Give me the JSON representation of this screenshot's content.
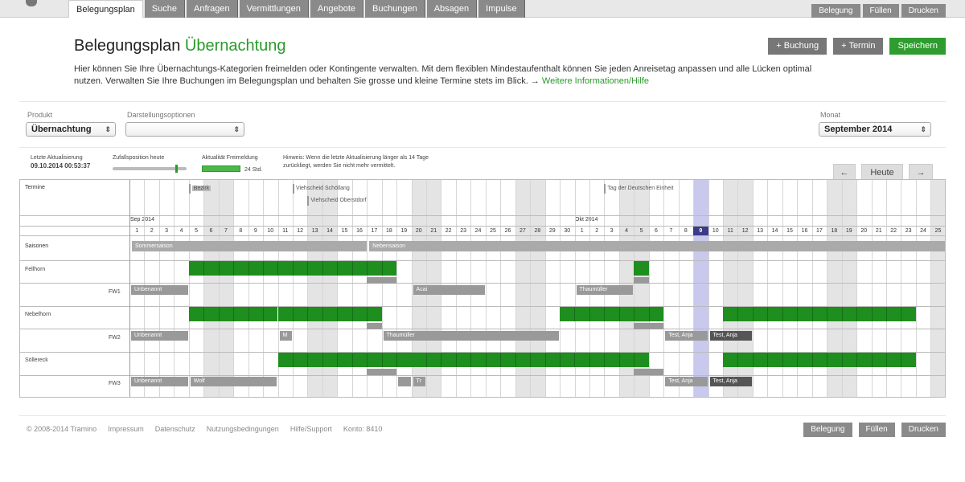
{
  "nav": {
    "tabs": [
      {
        "label": "Belegungsplan",
        "active": true
      },
      {
        "label": "Suche"
      },
      {
        "label": "Anfragen"
      },
      {
        "label": "Vermittlungen"
      },
      {
        "label": "Angebote"
      },
      {
        "label": "Buchungen"
      },
      {
        "label": "Absagen"
      },
      {
        "label": "Impulse"
      }
    ],
    "right_buttons": [
      "Belegung",
      "Füllen",
      "Drucken"
    ]
  },
  "header": {
    "title": "Belegungsplan",
    "subtitle": "Übernachtung",
    "add_booking": "+ Buchung",
    "add_appointment": "+ Termin",
    "save": "Speichern"
  },
  "description": {
    "text": "Hier können Sie Ihre Übernachtungs-Kategorien freimelden oder Kontingente verwalten. Mit dem flexiblen Mindestaufenthalt können Sie jeden Anreisetag anpassen und alle Lücken optimal nutzen. Verwalten Sie Ihre Buchungen im Belegungsplan und behalten Sie grosse und kleine Termine stets im Blick. →",
    "link": "Weitere Informationen/Hilfe"
  },
  "filters": {
    "product_label": "Produkt",
    "product_value": "Übernachtung",
    "options_label": "Darstellungsoptionen",
    "options_value": "",
    "month_label": "Monat",
    "month_value": "September 2014"
  },
  "status": {
    "last_update_label": "Letzte Aktualisierung",
    "last_update_value": "09.10.2014 00:53:37",
    "slider_label": "Zufallsposition heute",
    "freshness_label": "Aktualität Freimeldung",
    "freshness_value": "24 Std.",
    "hint": "Hinweis: Wenn die letzte Aktualisierung länger als 14 Tage zurückliegt, werden Sie nicht mehr vermittelt."
  },
  "navigation": {
    "prev": "←",
    "today": "Heute",
    "next": "→"
  },
  "calendar": {
    "termine_label": "Termine",
    "saisonen_label": "Saisonen",
    "month1": "Sep 2014",
    "month2": "Okt 2014",
    "events": [
      {
        "label": "Bezirk",
        "start": 5,
        "len": 2
      },
      {
        "label": "Viehscheid Schöllang",
        "start": 12,
        "len": 5
      },
      {
        "label": "Viehscheid Oberstdorf",
        "start": 13,
        "len": 5
      },
      {
        "label": "Tag der Deutschen Einheit",
        "start": 33,
        "len": 6
      }
    ],
    "seasons": [
      {
        "label": "Sommersaison",
        "start": 1,
        "len": 16
      },
      {
        "label": "Nebensaison",
        "start": 17,
        "len": 39
      }
    ],
    "today_index": 39,
    "rows": [
      {
        "name": "Fellhorn",
        "sub": "FW1",
        "green": [
          [
            5,
            14
          ],
          [
            35,
            1
          ]
        ],
        "sub_bars": [
          {
            "label": "Unbenannt",
            "start": 1,
            "len": 4
          },
          {
            "label": "Acai",
            "start": 20,
            "len": 5
          },
          {
            "label": "Thaumüller",
            "start": 31,
            "len": 4
          }
        ],
        "gray": [
          [
            17,
            2
          ],
          [
            35,
            1
          ]
        ]
      },
      {
        "name": "Nebelhorn",
        "sub": "FW2",
        "green": [
          [
            5,
            6
          ],
          [
            11,
            7
          ],
          [
            30,
            7
          ],
          [
            41,
            13
          ]
        ],
        "sub_bars": [
          {
            "label": "Unbenannt",
            "start": 1,
            "len": 4
          },
          {
            "label": "M",
            "start": 11,
            "len": 1
          },
          {
            "label": "Thaumüller",
            "start": 18,
            "len": 12
          },
          {
            "label": "Test, Anja",
            "start": 37,
            "len": 3
          },
          {
            "label": "Test, Anja",
            "start": 40,
            "len": 3,
            "dark": true
          }
        ],
        "gray": [
          [
            17,
            1
          ],
          [
            35,
            2
          ]
        ]
      },
      {
        "name": "Söllereck",
        "sub": "FW3",
        "green": [
          [
            11,
            9
          ],
          [
            20,
            16
          ],
          [
            41,
            13
          ]
        ],
        "sub_bars": [
          {
            "label": "Unbenannt",
            "start": 1,
            "len": 4
          },
          {
            "label": "Wolf",
            "start": 5,
            "len": 6
          },
          {
            "label": "",
            "start": 19,
            "len": 1
          },
          {
            "label": "Tr",
            "start": 20,
            "len": 1
          },
          {
            "label": "Test, Anja",
            "start": 37,
            "len": 3
          },
          {
            "label": "Test, Anja",
            "start": 40,
            "len": 3,
            "dark": true
          }
        ],
        "gray": [
          [
            17,
            2
          ],
          [
            35,
            2
          ]
        ]
      }
    ]
  },
  "footer": {
    "links": [
      "© 2008-2014 Tramino",
      "Impressum",
      "Datenschutz",
      "Nutzungsbedingungen",
      "Hilfe/Support",
      "Konto: 8410"
    ],
    "buttons": [
      "Belegung",
      "Füllen",
      "Drucken"
    ]
  }
}
